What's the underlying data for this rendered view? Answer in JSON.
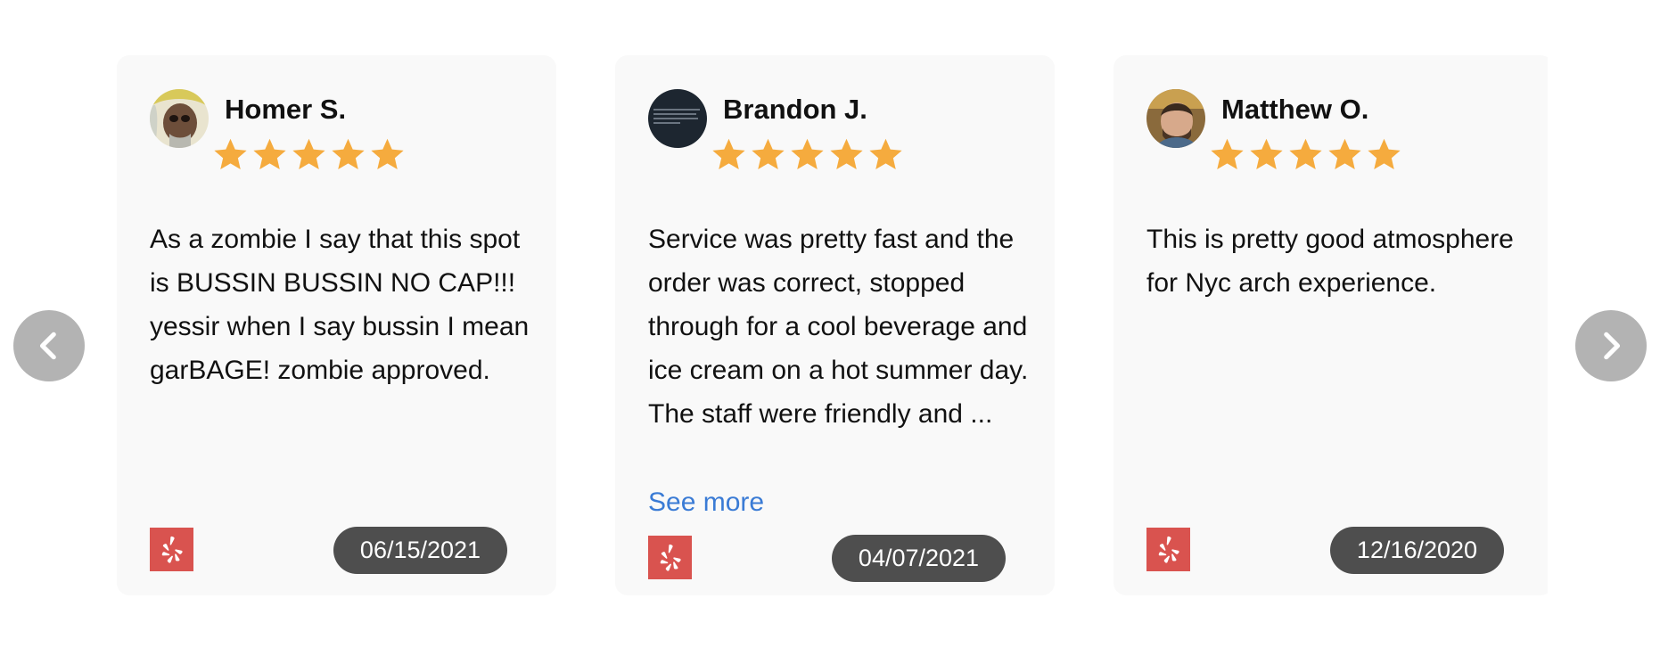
{
  "carousel": {
    "prev_icon": "chevron-left-icon",
    "next_icon": "chevron-right-icon",
    "reviews": [
      {
        "name": "Homer S.",
        "rating": 5,
        "text": "As a zombie I say that this spot is BUSSIN BUSSIN NO CAP!!! yessir when I say bussin I mean garBAGE! zombie approved.",
        "date": "06/15/2021",
        "source_icon": "yelp-icon"
      },
      {
        "name": "Brandon J.",
        "rating": 5,
        "text": "Service was pretty fast and the order was correct, stopped through for a cool beverage and ice cream on a hot summer day. The staff were friendly and ...",
        "see_more": "See more",
        "date": "04/07/2021",
        "source_icon": "yelp-icon"
      },
      {
        "name": "Matthew O.",
        "rating": 5,
        "text": "This is pretty good atmosphere for Nyc arch experience.",
        "date": "12/16/2020",
        "source_icon": "yelp-icon"
      }
    ]
  },
  "colors": {
    "star": "#f5ab3e",
    "yelp_badge": "#d9534f",
    "date_pill": "#4e4e4e",
    "link": "#3a7bd5",
    "arrow": "#b3b3b3",
    "card": "#f9f9f9"
  }
}
